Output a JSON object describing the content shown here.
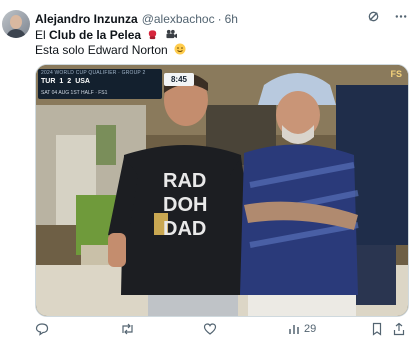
{
  "tweet": {
    "display_name": "Alejandro Inzunza",
    "handle": "@alexbachoc",
    "separator": "·",
    "time": "6h",
    "line1_prefix": "El ",
    "line1_bold": "Club de la Pelea",
    "line2": "Esta solo Edward Norton"
  },
  "media": {
    "broadcast_top": "2024 WORLD CUP QUALIFIER · GROUP 2",
    "team_home": "TUR",
    "score_home": "1",
    "score_away": "2",
    "team_away": "USA",
    "broadcast_bottom": "SAT 04 AUG 1ST HALF · FS1",
    "clock": "8:45",
    "watermark": "FS",
    "shirt_text": [
      "RAD",
      "DOH",
      "DAD"
    ]
  },
  "actions": {
    "views": "29"
  },
  "icons": {
    "grok": "grok-icon",
    "more": "more-icon",
    "reply": "reply-icon",
    "retweet": "retweet-icon",
    "like": "like-icon",
    "views": "views-icon",
    "bookmark": "bookmark-icon",
    "share": "share-icon"
  },
  "colors": {
    "text": "#0f1419",
    "muted": "#536471",
    "border": "#cfd9de"
  }
}
